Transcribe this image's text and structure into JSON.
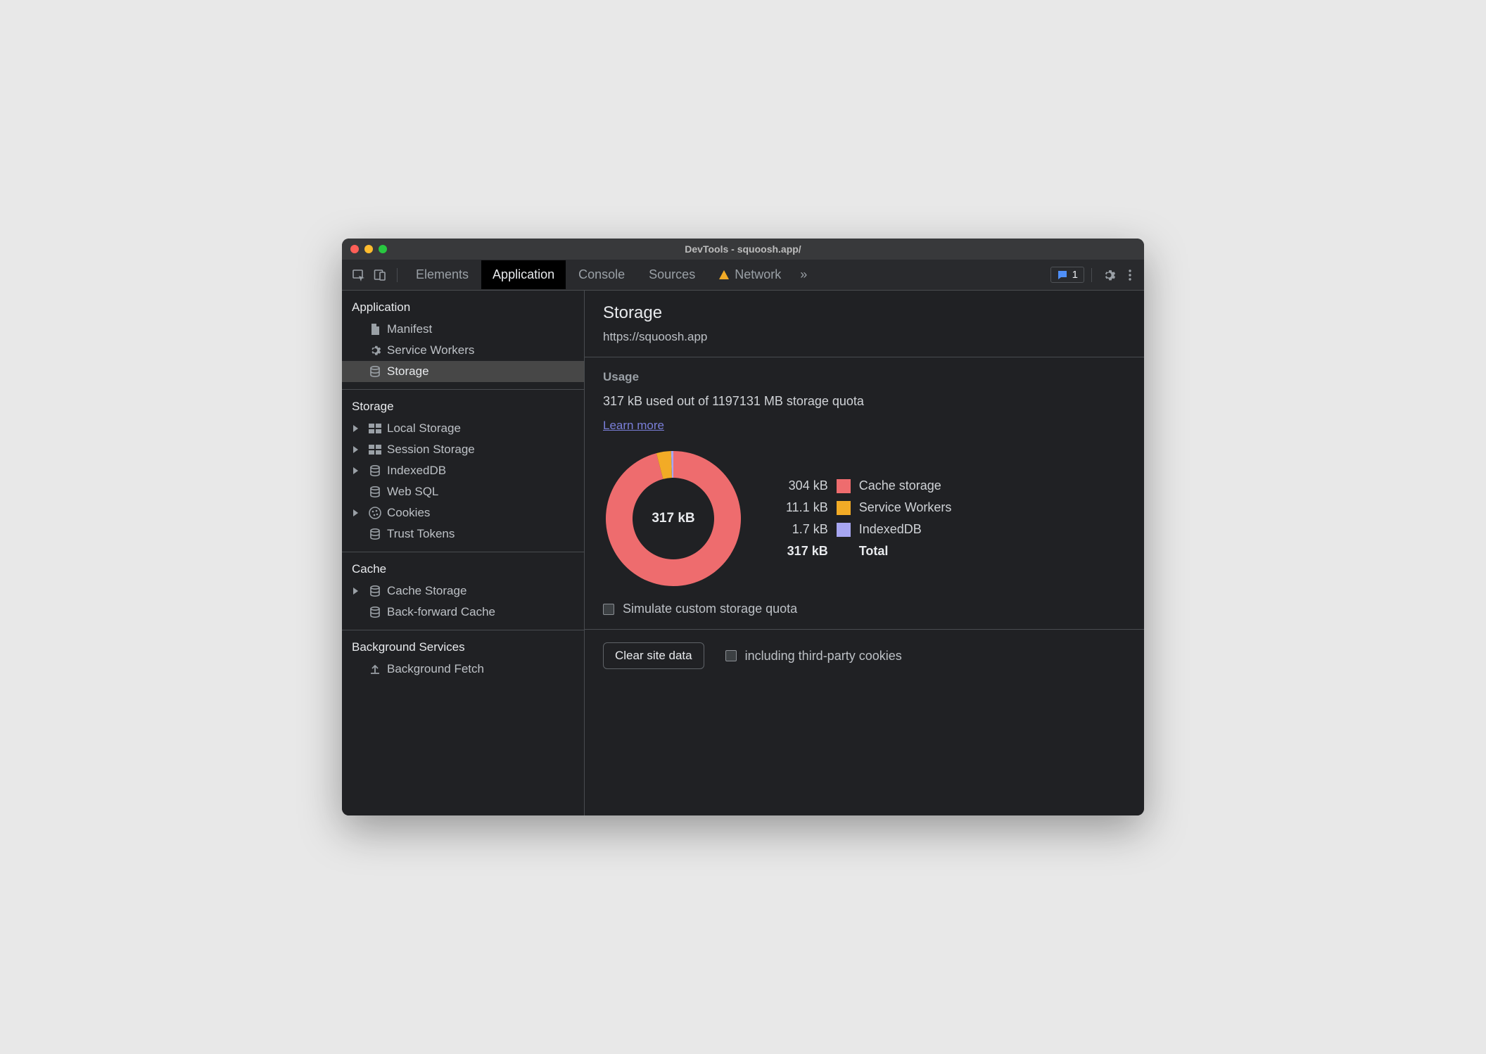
{
  "titlebar": {
    "title": "DevTools - squoosh.app/"
  },
  "toolbar": {
    "tabs": [
      {
        "label": "Elements"
      },
      {
        "label": "Application"
      },
      {
        "label": "Console"
      },
      {
        "label": "Sources"
      },
      {
        "label": "Network"
      }
    ],
    "issues_count": "1"
  },
  "sidebar": {
    "groups": [
      {
        "header": "Application",
        "items": [
          {
            "label": "Manifest"
          },
          {
            "label": "Service Workers"
          },
          {
            "label": "Storage"
          }
        ]
      },
      {
        "header": "Storage",
        "items": [
          {
            "label": "Local Storage"
          },
          {
            "label": "Session Storage"
          },
          {
            "label": "IndexedDB"
          },
          {
            "label": "Web SQL"
          },
          {
            "label": "Cookies"
          },
          {
            "label": "Trust Tokens"
          }
        ]
      },
      {
        "header": "Cache",
        "items": [
          {
            "label": "Cache Storage"
          },
          {
            "label": "Back-forward Cache"
          }
        ]
      },
      {
        "header": "Background Services",
        "items": [
          {
            "label": "Background Fetch"
          }
        ]
      }
    ]
  },
  "main": {
    "title": "Storage",
    "origin": "https://squoosh.app",
    "usage_header": "Usage",
    "usage_text": "317 kB used out of 1197131 MB storage quota",
    "learn_more": "Learn more",
    "donut_center": "317 kB",
    "legend": [
      {
        "value": "304 kB",
        "color": "#ee6c6e",
        "label": "Cache storage"
      },
      {
        "value": "11.1 kB",
        "color": "#f2ab26",
        "label": "Service Workers"
      },
      {
        "value": "1.7 kB",
        "color": "#a7a6f2",
        "label": "IndexedDB"
      }
    ],
    "total_value": "317 kB",
    "total_label": "Total",
    "simulate_label": "Simulate custom storage quota",
    "clear_button": "Clear site data",
    "third_party_label": "including third-party cookies"
  },
  "chart_data": {
    "type": "pie",
    "title": "Storage usage breakdown",
    "categories": [
      "Cache storage",
      "Service Workers",
      "IndexedDB"
    ],
    "values": [
      304,
      11.1,
      1.7
    ],
    "unit": "kB",
    "total": 317,
    "colors": [
      "#ee6c6e",
      "#f2ab26",
      "#a7a6f2"
    ]
  }
}
